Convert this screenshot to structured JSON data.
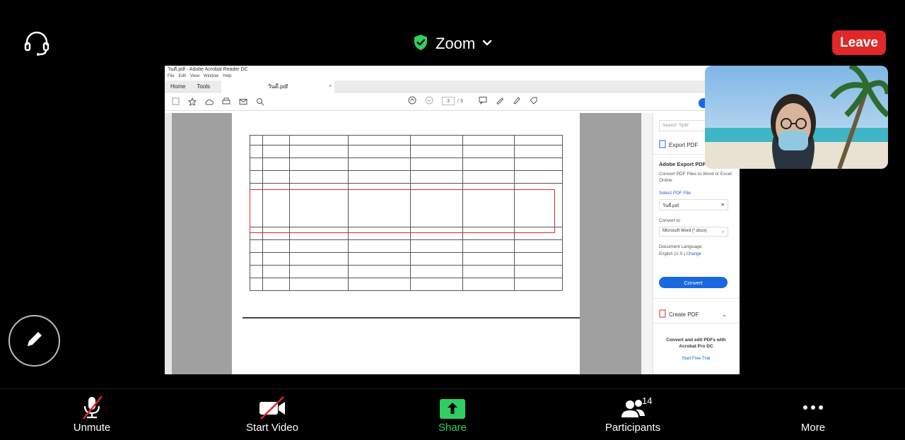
{
  "meeting": {
    "title": "Zoom",
    "leave_label": "Leave",
    "accent_green": "#2fce62",
    "leave_color": "#e02828"
  },
  "icons": {
    "audio": "headset-icon",
    "secure": "shield-check-icon",
    "title_dropdown": "chevron-down-icon",
    "annotate": "pencil-icon"
  },
  "acrobat": {
    "window_title": "วันดี.pdf - Adobe Acrobat Reader DC",
    "menu": [
      "File",
      "Edit",
      "View",
      "Window",
      "Help"
    ],
    "tabs": {
      "home": "Home",
      "tools": "Tools",
      "doc": "วันดี.pdf",
      "close": "×"
    },
    "page_current": "3",
    "page_total": "/ 3",
    "side_panel": {
      "search_placeholder": "Search 'Split'",
      "export_label": "Export PDF",
      "export_heading": "Adobe Export PDF",
      "export_desc": "Convert PDF Files to Word or Excel Online",
      "select_file": "Select PDF File",
      "file_name": "วันดี.pdf",
      "convert_to": "Convert to",
      "format": "Microsoft Word (*.docx)",
      "doc_language": "Document Language:",
      "language": "English (U.S.)",
      "change": "Change",
      "convert_button": "Convert",
      "create_pdf": "Create PDF",
      "promo": "Convert and edit PDFs with Acrobat Pro DC",
      "trial": "Start Free Trial"
    }
  },
  "toolbar": {
    "unmute": "Unmute",
    "start_video": "Start Video",
    "share": "Share",
    "participants": "Participants",
    "participants_count": "14",
    "more": "More"
  }
}
